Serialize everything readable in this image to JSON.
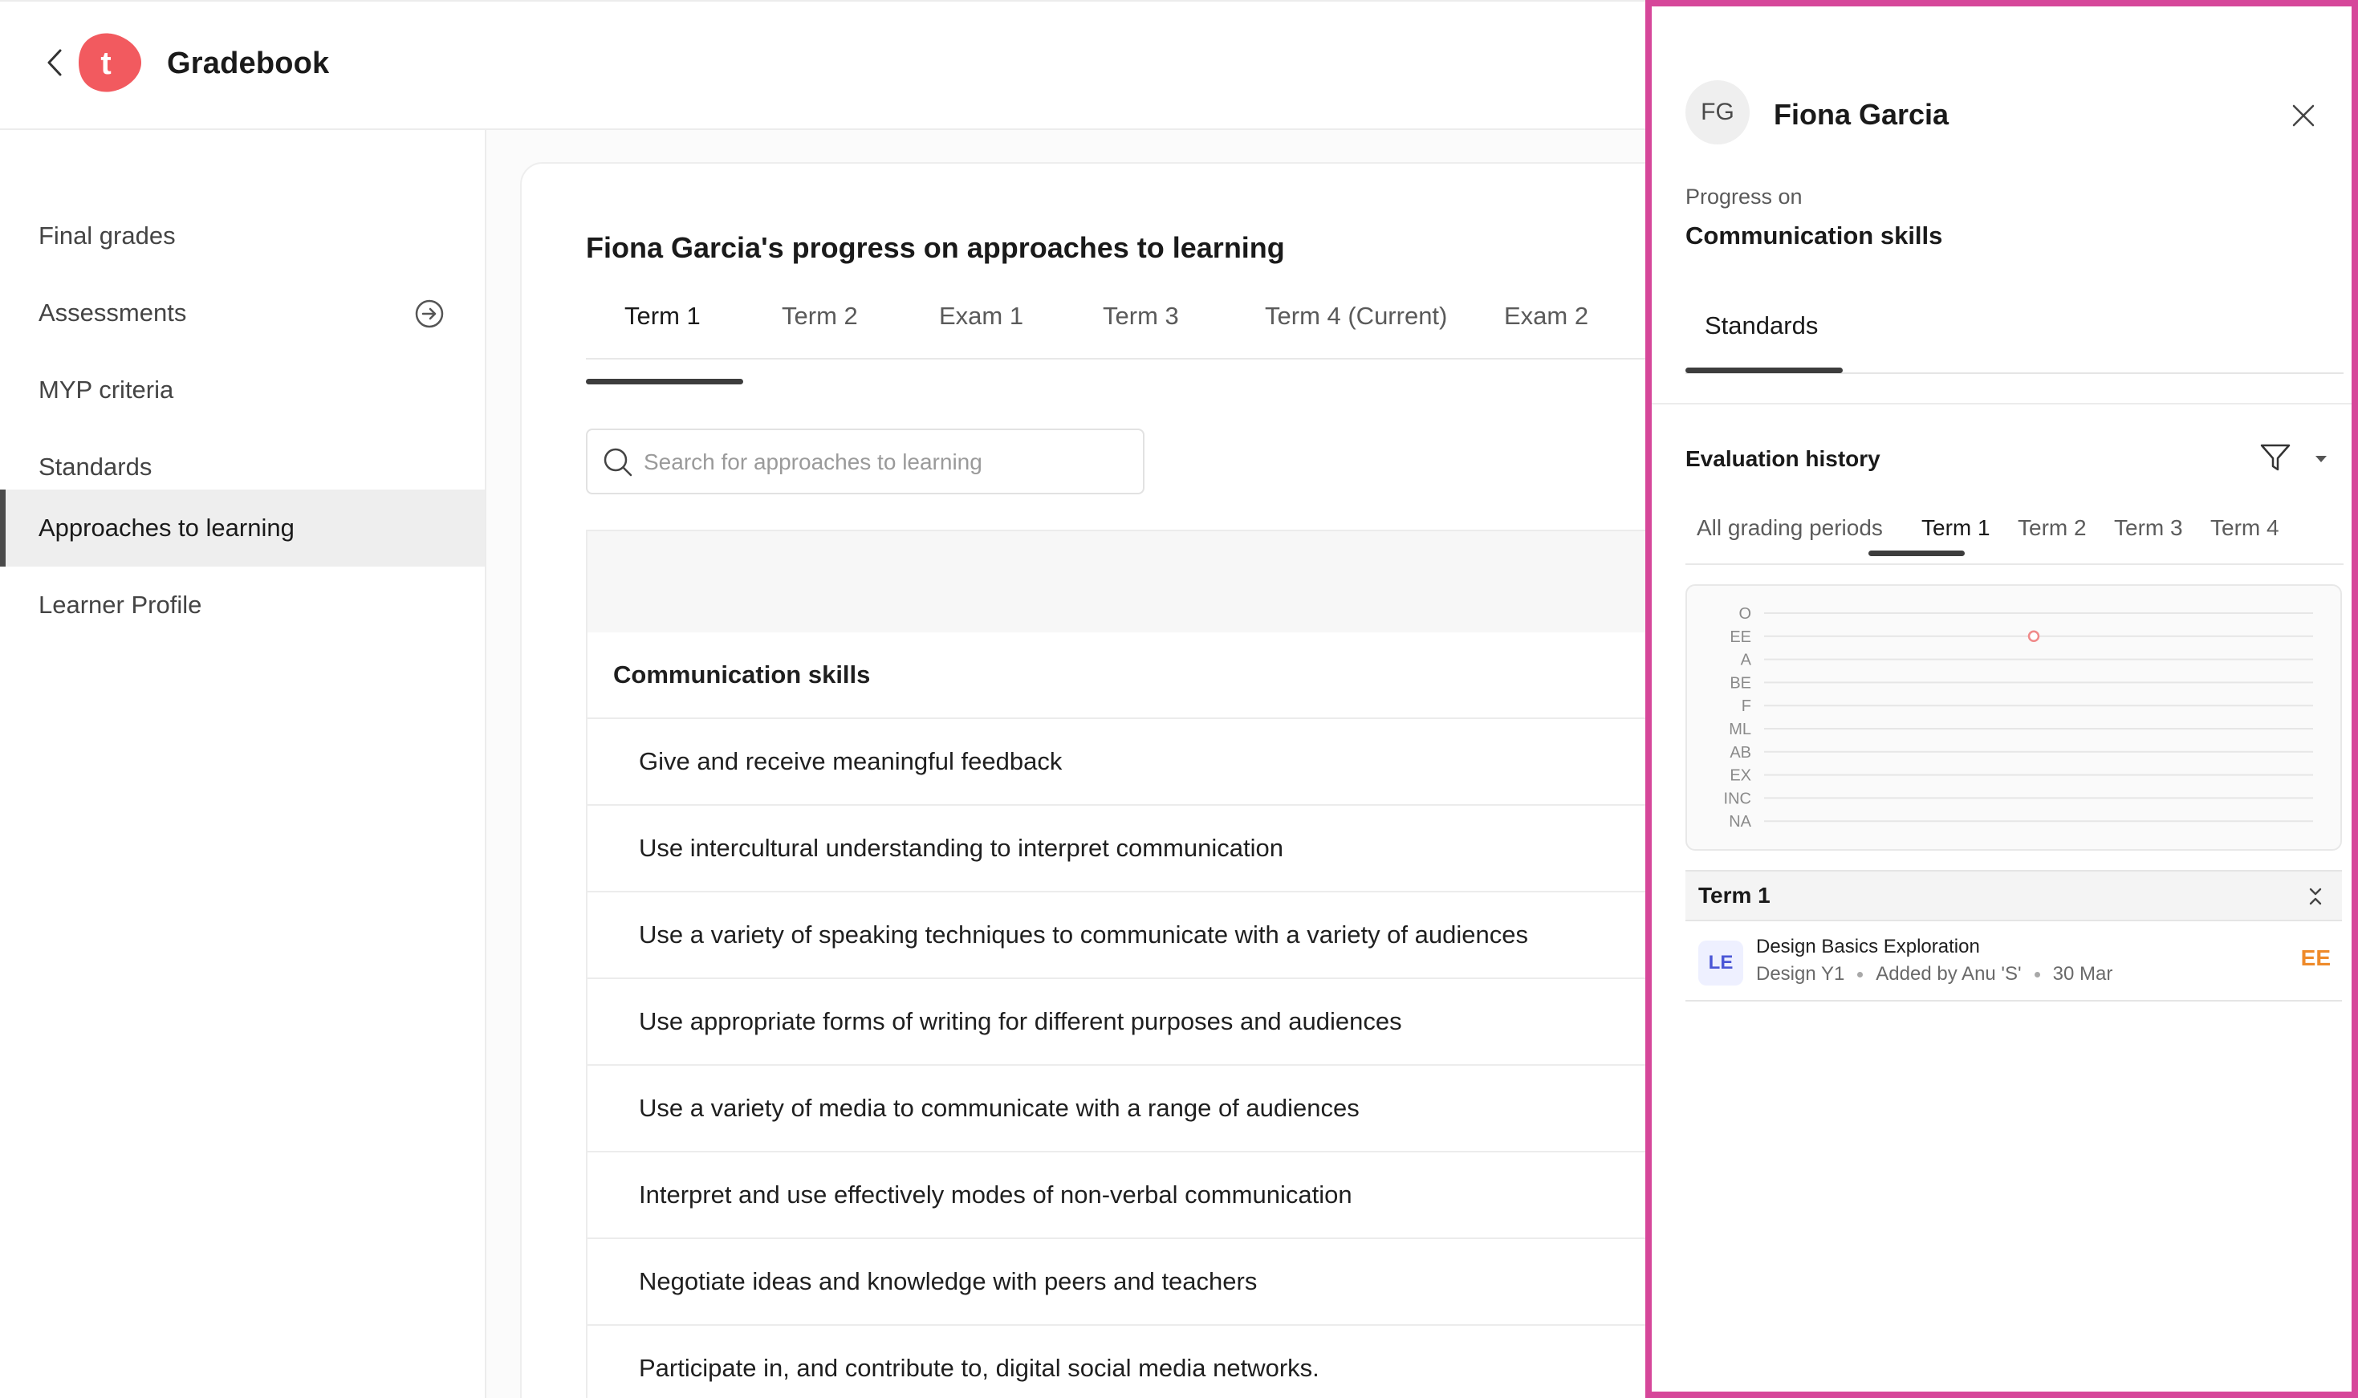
{
  "header": {
    "title": "Gradebook",
    "logo_letter": "t",
    "brand_color": "#f25a5f"
  },
  "sidebar": {
    "items": [
      {
        "label": "Final grades"
      },
      {
        "label": "Assessments",
        "icon": "arrow-right-circle-icon"
      },
      {
        "label": "MYP criteria"
      },
      {
        "label": "Standards"
      },
      {
        "label": "Approaches to learning",
        "active": true
      },
      {
        "label": "Learner Profile"
      }
    ]
  },
  "main": {
    "title": "Fiona Garcia's progress on approaches to learning",
    "tabs": [
      {
        "label": "Term 1",
        "active": true
      },
      {
        "label": "Term 2"
      },
      {
        "label": "Exam 1"
      },
      {
        "label": "Term 3"
      },
      {
        "label": "Term 4 (Current)"
      },
      {
        "label": "Exam 2"
      }
    ],
    "search": {
      "placeholder": "Search for approaches to learning",
      "value": ""
    },
    "rows": [
      {
        "label": "Communication skills",
        "type": "group"
      },
      {
        "label": "Give and receive meaningful feedback",
        "type": "item"
      },
      {
        "label": "Use intercultural understanding to interpret communication",
        "type": "item"
      },
      {
        "label": "Use a variety of speaking techniques to communicate with a variety of audiences",
        "type": "item"
      },
      {
        "label": "Use appropriate forms of writing for different purposes and audiences",
        "type": "item"
      },
      {
        "label": "Use a variety of media to communicate with a range of audiences",
        "type": "item"
      },
      {
        "label": "Interpret and use effectively modes of non-verbal communication",
        "type": "item"
      },
      {
        "label": "Negotiate ideas and knowledge with peers and teachers",
        "type": "item"
      },
      {
        "label": "Participate in, and contribute to, digital social media networks.",
        "type": "item"
      }
    ]
  },
  "panel": {
    "initials": "FG",
    "name": "Fiona Garcia",
    "progress_label": "Progress on",
    "skill": "Communication skills",
    "tabs": [
      {
        "label": "Standards",
        "active": true
      }
    ],
    "evaluation_title": "Evaluation history",
    "period_tabs": [
      {
        "label": "All grading periods"
      },
      {
        "label": "Term 1",
        "active": true
      },
      {
        "label": "Term 2"
      },
      {
        "label": "Term 3"
      },
      {
        "label": "Term 4"
      }
    ],
    "term_header": "Term 1",
    "entry": {
      "badge": "LE",
      "title": "Design Basics Exploration",
      "course": "Design Y1",
      "added_by": "Added by Anu 'S'",
      "date": "30 Mar",
      "grade": "EE",
      "grade_color": "#ee8a2a"
    },
    "accent_color": "#d6479a"
  },
  "chart_data": {
    "type": "scatter",
    "categories": [
      "O",
      "EE",
      "A",
      "BE",
      "F",
      "ML",
      "AB",
      "EX",
      "INC",
      "NA"
    ],
    "points": [
      {
        "x": 1,
        "y": "EE"
      }
    ],
    "point_color": "#f08a8a",
    "grid": true
  }
}
